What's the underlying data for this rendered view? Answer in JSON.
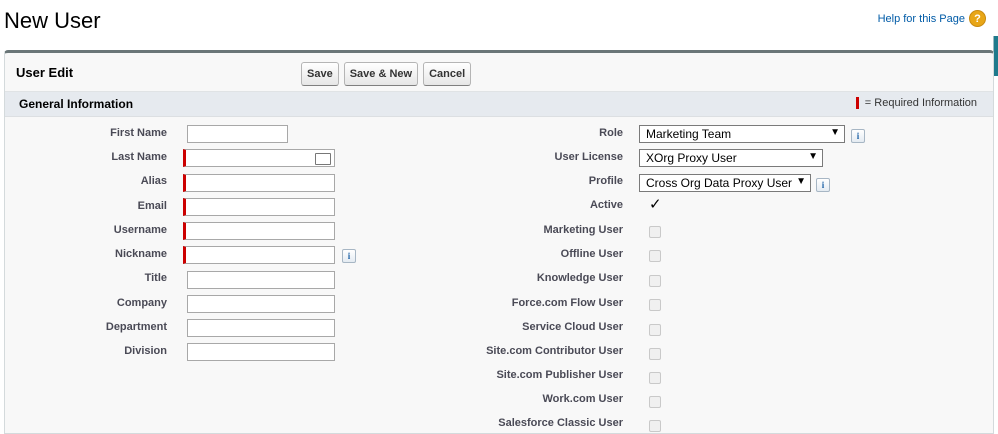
{
  "page": {
    "title": "New User",
    "help_link": "Help for this Page",
    "help_icon": "?"
  },
  "panel": {
    "title": "User Edit"
  },
  "buttons": {
    "save": "Save",
    "save_new": "Save & New",
    "cancel": "Cancel"
  },
  "section": {
    "title": "General Information",
    "required_legend": "= Required Information"
  },
  "left_fields": [
    {
      "label": "First Name",
      "value": "",
      "required": false
    },
    {
      "label": "Last Name",
      "value": "",
      "required": true
    },
    {
      "label": "Alias",
      "value": "",
      "required": true
    },
    {
      "label": "Email",
      "value": "",
      "required": true
    },
    {
      "label": "Username",
      "value": "",
      "required": true
    },
    {
      "label": "Nickname",
      "value": "",
      "required": true
    },
    {
      "label": "Title",
      "value": "",
      "required": false
    },
    {
      "label": "Company",
      "value": "",
      "required": false
    },
    {
      "label": "Department",
      "value": "",
      "required": false
    },
    {
      "label": "Division",
      "value": "",
      "required": false
    }
  ],
  "right_fields": {
    "role": {
      "label": "Role",
      "value": "Marketing Team"
    },
    "user_license": {
      "label": "User License",
      "value": "XOrg Proxy User"
    },
    "profile": {
      "label": "Profile",
      "value": "Cross Org Data Proxy User"
    },
    "active": {
      "label": "Active",
      "checked": true
    },
    "checkboxes": [
      {
        "label": "Marketing User",
        "checked": false
      },
      {
        "label": "Offline User",
        "checked": false
      },
      {
        "label": "Knowledge User",
        "checked": false
      },
      {
        "label": "Force.com Flow User",
        "checked": false
      },
      {
        "label": "Service Cloud User",
        "checked": false
      },
      {
        "label": "Site.com Contributor User",
        "checked": false
      },
      {
        "label": "Site.com Publisher User",
        "checked": false
      },
      {
        "label": "Work.com User",
        "checked": false
      },
      {
        "label": "Salesforce Classic User",
        "checked": false
      }
    ]
  },
  "icons": {
    "info": "i",
    "arrow": "▼",
    "check": "✓"
  },
  "colors": {
    "required": "#cc0000",
    "link": "#015ba7",
    "header_bar": "#e6eaef"
  }
}
